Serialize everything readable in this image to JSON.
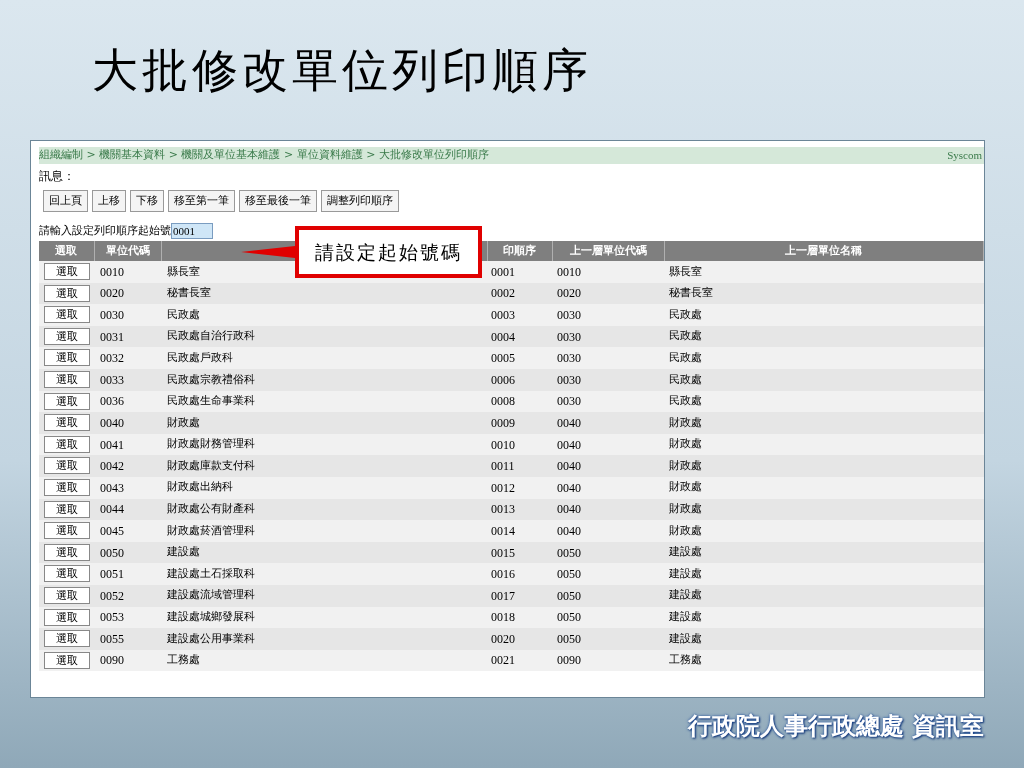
{
  "slide_title": "大批修改單位列印順序",
  "breadcrumb": "組織編制 > 機關基本資料 > 機關及單位基本維護 > 單位資料維護 > 大批修改單位列印順序",
  "brand": "Syscom",
  "message_label": "訊息：",
  "toolbar": [
    "回上頁",
    "上移",
    "下移",
    "移至第一筆",
    "移至最後一筆",
    "調整列印順序"
  ],
  "start_field": {
    "label": "請輸入設定列印順序起始號",
    "value": "0001"
  },
  "callout": "請設定起始號碼",
  "table": {
    "columns": [
      "選取",
      "單位代碼",
      "",
      "印順序",
      "上一層單位代碼",
      "上一層單位名稱"
    ],
    "rows": [
      {
        "action": "選取",
        "code": "0010",
        "name": "縣長室",
        "order": "0001",
        "parent_code": "0010",
        "parent_name": "縣長室"
      },
      {
        "action": "選取",
        "code": "0020",
        "name": "秘書長室",
        "order": "0002",
        "parent_code": "0020",
        "parent_name": "秘書長室"
      },
      {
        "action": "選取",
        "code": "0030",
        "name": "民政處",
        "order": "0003",
        "parent_code": "0030",
        "parent_name": "民政處"
      },
      {
        "action": "選取",
        "code": "0031",
        "name": "民政處自治行政科",
        "order": "0004",
        "parent_code": "0030",
        "parent_name": "民政處"
      },
      {
        "action": "選取",
        "code": "0032",
        "name": "民政處戶政科",
        "order": "0005",
        "parent_code": "0030",
        "parent_name": "民政處"
      },
      {
        "action": "選取",
        "code": "0033",
        "name": "民政處宗教禮俗科",
        "order": "0006",
        "parent_code": "0030",
        "parent_name": "民政處"
      },
      {
        "action": "選取",
        "code": "0036",
        "name": "民政處生命事業科",
        "order": "0008",
        "parent_code": "0030",
        "parent_name": "民政處"
      },
      {
        "action": "選取",
        "code": "0040",
        "name": "財政處",
        "order": "0009",
        "parent_code": "0040",
        "parent_name": "財政處"
      },
      {
        "action": "選取",
        "code": "0041",
        "name": "財政處財務管理科",
        "order": "0010",
        "parent_code": "0040",
        "parent_name": "財政處"
      },
      {
        "action": "選取",
        "code": "0042",
        "name": "財政處庫款支付科",
        "order": "0011",
        "parent_code": "0040",
        "parent_name": "財政處"
      },
      {
        "action": "選取",
        "code": "0043",
        "name": "財政處出納科",
        "order": "0012",
        "parent_code": "0040",
        "parent_name": "財政處"
      },
      {
        "action": "選取",
        "code": "0044",
        "name": "財政處公有財產科",
        "order": "0013",
        "parent_code": "0040",
        "parent_name": "財政處"
      },
      {
        "action": "選取",
        "code": "0045",
        "name": "財政處菸酒管理科",
        "order": "0014",
        "parent_code": "0040",
        "parent_name": "財政處"
      },
      {
        "action": "選取",
        "code": "0050",
        "name": "建設處",
        "order": "0015",
        "parent_code": "0050",
        "parent_name": "建設處"
      },
      {
        "action": "選取",
        "code": "0051",
        "name": "建設處土石採取科",
        "order": "0016",
        "parent_code": "0050",
        "parent_name": "建設處"
      },
      {
        "action": "選取",
        "code": "0052",
        "name": "建設處流域管理科",
        "order": "0017",
        "parent_code": "0050",
        "parent_name": "建設處"
      },
      {
        "action": "選取",
        "code": "0053",
        "name": "建設處城鄉發展科",
        "order": "0018",
        "parent_code": "0050",
        "parent_name": "建設處"
      },
      {
        "action": "選取",
        "code": "0055",
        "name": "建設處公用事業科",
        "order": "0020",
        "parent_code": "0050",
        "parent_name": "建設處"
      },
      {
        "action": "選取",
        "code": "0090",
        "name": "工務處",
        "order": "0021",
        "parent_code": "0090",
        "parent_name": "工務處"
      }
    ]
  },
  "footer": "行政院人事行政總處 資訊室"
}
